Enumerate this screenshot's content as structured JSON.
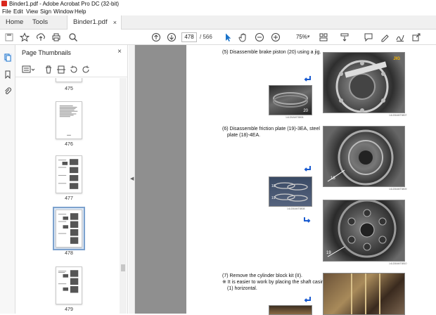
{
  "window": {
    "title": "Binder1.pdf - Adobe Acrobat Pro DC (32-bit)"
  },
  "menu": {
    "items": [
      "File",
      "Edit",
      "View",
      "Sign",
      "Window",
      "Help"
    ]
  },
  "tabs": {
    "home": "Home",
    "tools": "Tools",
    "document": "Binder1.pdf",
    "close": "×"
  },
  "toolbar": {
    "current_page": "478",
    "total_pages": "/ 566",
    "zoom": "75%",
    "zoom_drop": "▾"
  },
  "panel": {
    "title": "Page Thumbnails",
    "close": "×",
    "thumbnails": [
      {
        "page": "475"
      },
      {
        "page": "476"
      },
      {
        "page": "477"
      },
      {
        "page": "478",
        "selected": true
      },
      {
        "page": "479"
      }
    ]
  },
  "document": {
    "step5": "(5) Disassemble brake piston (20) using a jig.",
    "step6_line1": "(6) Disassemble friction plate (19)-3EA, steel",
    "step6_line2": "plate (18)-4EA.",
    "step7_line1": "(7) Remove the cylinder block kit (II).",
    "step7_line2": "※ It is easier to work by placing the shaft casing",
    "step7_line3": "(1) horizontal.",
    "label_jig": "JIG",
    "label_20": "20",
    "label_18a": "18",
    "label_19a": "19",
    "label_18b": "18",
    "label_19b": "19",
    "cap1": "14LD5AMT8806",
    "cap2": "14LD5AMT8807",
    "cap3": "14LD5AMT8808",
    "cap4": "14LD5AMT8809",
    "cap5": "14LD5AMT8810"
  },
  "colors": {
    "accent": "#1a73c9",
    "toolbar_bg": "#ffffff",
    "canvas_bg": "#8f8f8f",
    "selection": "#7da2ce"
  }
}
